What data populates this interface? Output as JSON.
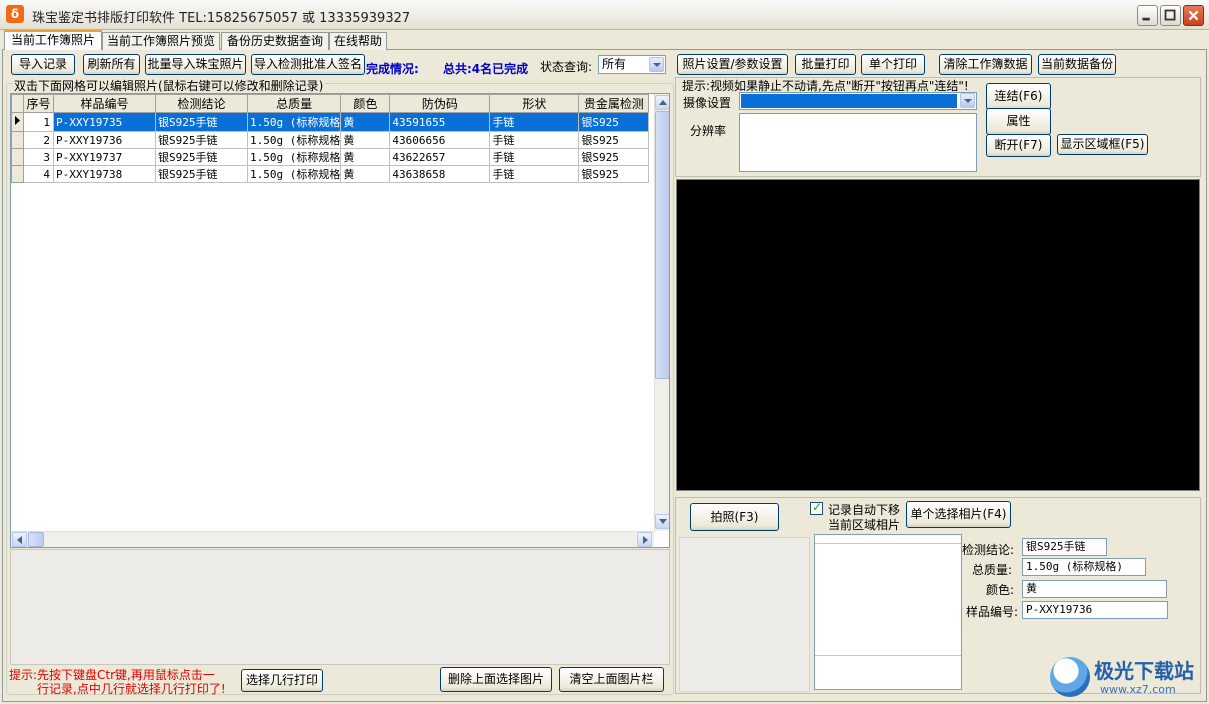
{
  "window": {
    "title": "珠宝鉴定书排版打印软件 TEL:15825675057 或 13335939327",
    "icon_char": "δ"
  },
  "tabs": [
    {
      "label": "当前工作簿照片",
      "active": true
    },
    {
      "label": "当前工作簿照片预览",
      "active": false
    },
    {
      "label": "备份历史数据查询",
      "active": false
    },
    {
      "label": "在线帮助",
      "active": false
    }
  ],
  "toolbar": {
    "import_record": "导入记录",
    "refresh_all": "刷新所有",
    "batch_import_photos": "批量导入珠宝照片",
    "import_approver_signature": "导入检测批准人签名",
    "completion_label": "完成情况:",
    "total_status": "总共:4名已完成",
    "status_query_label": "状态查询:",
    "status_query_value": "所有",
    "photo_settings": "照片设置/参数设置",
    "batch_print": "批量打印",
    "single_print": "单个打印",
    "clear_workbook": "清除工作簿数据",
    "backup_current": "当前数据备份"
  },
  "grid": {
    "caption": "双击下面网格可以编辑照片(鼠标右键可以修改和删除记录)",
    "columns": [
      "序号",
      "样品编号",
      "检测结论",
      "总质量",
      "颜色",
      "防伪码",
      "形状",
      "贵金属检测"
    ],
    "rows": [
      [
        "1",
        "P-XXY19735",
        "银S925手链",
        "1.50g (标称规格",
        "黄",
        "43591655",
        "手链",
        "银S925"
      ],
      [
        "2",
        "P-XXY19736",
        "银S925手链",
        "1.50g (标称规格",
        "黄",
        "43606656",
        "手链",
        "银S925"
      ],
      [
        "3",
        "P-XXY19737",
        "银S925手链",
        "1.50g (标称规格",
        "黄",
        "43622657",
        "手链",
        "银S925"
      ],
      [
        "4",
        "P-XXY19738",
        "银S925手链",
        "1.50g (标称规格",
        "黄",
        "43638658",
        "手链",
        "银S925"
      ]
    ],
    "selected_row": 0
  },
  "bottom_left": {
    "hint_line1": "提示:先按下键盘Ctr键,再用鼠标点击一",
    "hint_line2": "行记录,点中几行就选择几行打印了!",
    "select_rows_print": "选择几行打印",
    "delete_selected_photo": "删除上面选择图片",
    "clear_photo_bar": "清空上面图片栏"
  },
  "camera": {
    "hint": "提示:视频如果静止不动请,先点\"断开\"按钮再点\"连结\"!",
    "device_label": "摄像设置",
    "resolution_label": "分辨率",
    "connect": "连结(F6)",
    "properties": "属性",
    "disconnect": "断开(F7)",
    "show_region": "显示区域框(F5)"
  },
  "capture": {
    "take_photo": "拍照(F3)",
    "auto_move_label_1": "记录自动下移",
    "auto_move_label_2": "当前区域相片",
    "auto_move_checked": true,
    "select_single_photo": "单个选择相片(F4)",
    "fields": [
      {
        "label": "检测结论:",
        "value": "银S925手链"
      },
      {
        "label": "总质量:",
        "value": "1.50g (标称规格)"
      },
      {
        "label": "颜色:",
        "value": "黄"
      },
      {
        "label": "样品编号:",
        "value": "P-XXY19736"
      }
    ]
  },
  "watermark": {
    "brand": "极光下载站",
    "url": "www.xz7.com"
  },
  "colors": {
    "selection_blue": "#0a6fd6",
    "hint_red": "#e00000",
    "status_blue": "#0000cc"
  }
}
